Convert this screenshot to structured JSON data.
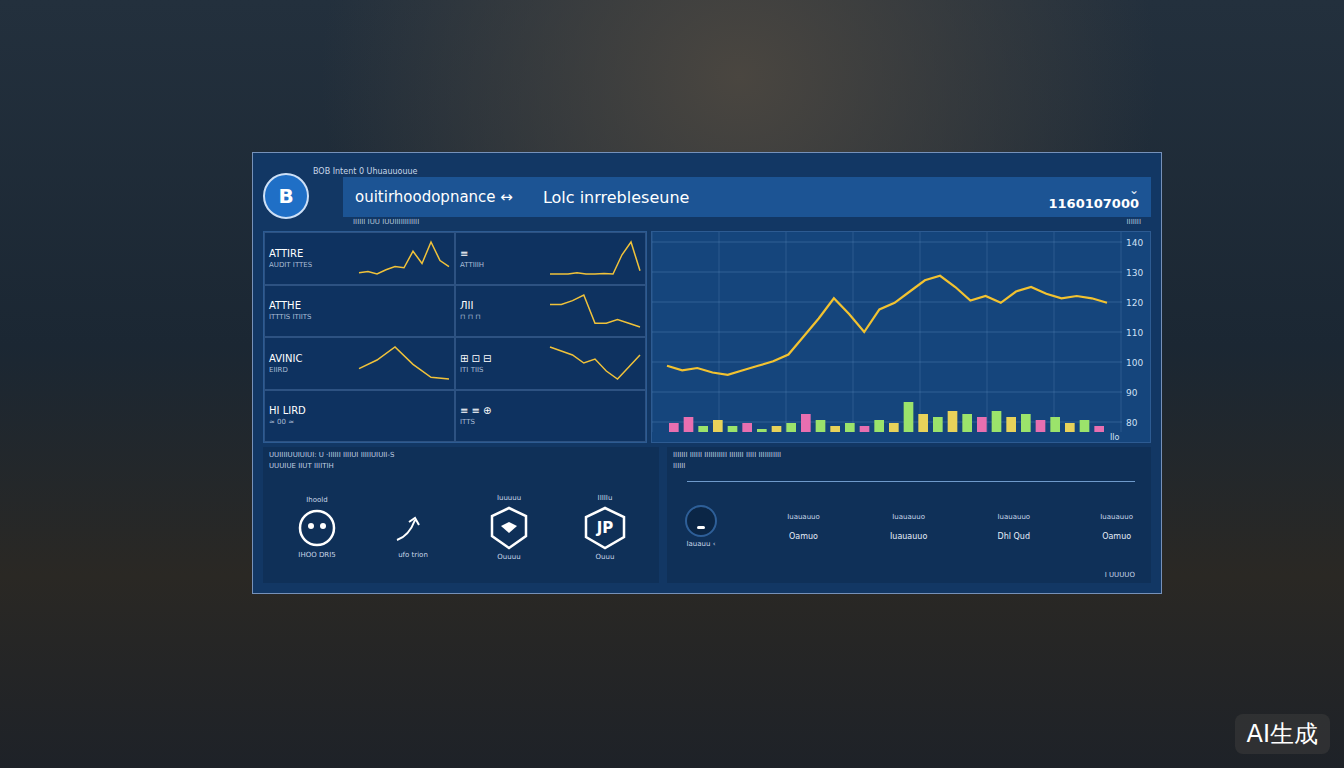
{
  "header": {
    "logo": "B",
    "caption": "BOB Intent 0 Uhuauuouue",
    "title": "ouitirhoodopnance ↔",
    "subtitle": "Lolc inrrebleseune",
    "value": "1160107000",
    "menu": "⌄",
    "sub_left": "IIIIII IUU IUUIIIIIIIIIIII",
    "sub_right": "IIIIIII"
  },
  "tiles": [
    {
      "label": "ATTIRE",
      "note": "AUDIT ITTES",
      "series": [
        20,
        22,
        18,
        25,
        30,
        28,
        55,
        35,
        70,
        40,
        30
      ]
    },
    {
      "label": "≡",
      "note": "ATTIIIH",
      "series": [
        10,
        10,
        10,
        12,
        10,
        10,
        11,
        10,
        40,
        60,
        15
      ]
    },
    {
      "label": "ATTHE",
      "note": "ITTTIS ITIITS",
      "series": []
    },
    {
      "label": "ЛII",
      "note": "⊓ ⊓ ⊓",
      "series": [
        40,
        40,
        42,
        45,
        30,
        30,
        32,
        30,
        28
      ]
    },
    {
      "label": "AVINIC",
      "note": "EIIRD",
      "series": [
        30,
        40,
        55,
        35,
        20,
        18
      ]
    },
    {
      "label": "⊞ ⊡ ⊟",
      "note": "ITI TIIS",
      "series": [
        60,
        55,
        50,
        40,
        45,
        30,
        20,
        35,
        50
      ]
    },
    {
      "label": "HI LIRD",
      "note": "≈ 00 ≈",
      "series": []
    },
    {
      "label": "≡ ≡ ⊕",
      "note": "ITTS",
      "series": []
    }
  ],
  "chart": {
    "ticks": [
      "140",
      "130",
      "120",
      "110",
      "100",
      "90",
      "80"
    ],
    "x_label": "Ilo",
    "line": [
      95,
      93,
      94,
      92,
      91,
      93,
      95,
      97,
      100,
      108,
      116,
      125,
      118,
      110,
      120,
      123,
      128,
      133,
      135,
      130,
      124,
      126,
      123,
      128,
      130,
      127,
      125,
      126,
      125,
      123
    ],
    "bars": [
      {
        "value": 3,
        "color": "#e86fb0"
      },
      {
        "value": 5,
        "color": "#e86fb0"
      },
      {
        "value": 2,
        "color": "#9be36b"
      },
      {
        "value": 4,
        "color": "#e8d25a"
      },
      {
        "value": 2,
        "color": "#9be36b"
      },
      {
        "value": 3,
        "color": "#e86fb0"
      },
      {
        "value": 1,
        "color": "#9be36b"
      },
      {
        "value": 2,
        "color": "#e8d25a"
      },
      {
        "value": 3,
        "color": "#9be36b"
      },
      {
        "value": 6,
        "color": "#e86fb0"
      },
      {
        "value": 4,
        "color": "#9be36b"
      },
      {
        "value": 2,
        "color": "#e8d25a"
      },
      {
        "value": 3,
        "color": "#9be36b"
      },
      {
        "value": 2,
        "color": "#e86fb0"
      },
      {
        "value": 4,
        "color": "#9be36b"
      },
      {
        "value": 3,
        "color": "#e8d25a"
      },
      {
        "value": 10,
        "color": "#9be36b"
      },
      {
        "value": 6,
        "color": "#e8d25a"
      },
      {
        "value": 5,
        "color": "#9be36b"
      },
      {
        "value": 7,
        "color": "#e8d25a"
      },
      {
        "value": 6,
        "color": "#9be36b"
      },
      {
        "value": 5,
        "color": "#e86fb0"
      },
      {
        "value": 7,
        "color": "#9be36b"
      },
      {
        "value": 5,
        "color": "#e8d25a"
      },
      {
        "value": 6,
        "color": "#9be36b"
      },
      {
        "value": 4,
        "color": "#e86fb0"
      },
      {
        "value": 5,
        "color": "#9be36b"
      },
      {
        "value": 3,
        "color": "#e8d25a"
      },
      {
        "value": 4,
        "color": "#9be36b"
      },
      {
        "value": 2,
        "color": "#e86fb0"
      }
    ]
  },
  "left_info": [
    "UUIIIIUUIUIUI: U ·IIIIII IIIIUI IIIIIUIUII-S",
    "UUUIUE IIUT IIIITIH"
  ],
  "right_info": [
    "IIIIIII IIIIII  IIIIIIIIIII IIIIIII IIIII IIIIIIIIIII",
    "IIIIII"
  ],
  "actions": [
    {
      "kind": "face",
      "top": "Ihoold",
      "bottom": "IHOO DRI5",
      "glyph": ""
    },
    {
      "kind": "arrow",
      "top": "",
      "bottom": "ufo trion",
      "glyph": ""
    },
    {
      "kind": "shield",
      "top": "Iuuuuu",
      "bottom": "Ouuuu",
      "glyph": ""
    },
    {
      "kind": "badge",
      "top": "IIIIIu",
      "bottom": "Ouuu",
      "glyph": "JP"
    }
  ],
  "knob": {
    "caption": "Iauauu ‹"
  },
  "stats": [
    {
      "top": "Iuauauuo",
      "bottom": "Oamuo"
    },
    {
      "top": "Iuauauuo",
      "bottom": "Iuauauuo"
    },
    {
      "top": "Iuauauuo",
      "bottom": "Dhl Qud"
    },
    {
      "top": "Iuauauuo",
      "bottom": "Oamuo"
    }
  ],
  "footer_right": "I UUUUO",
  "watermark": "AI生成"
}
